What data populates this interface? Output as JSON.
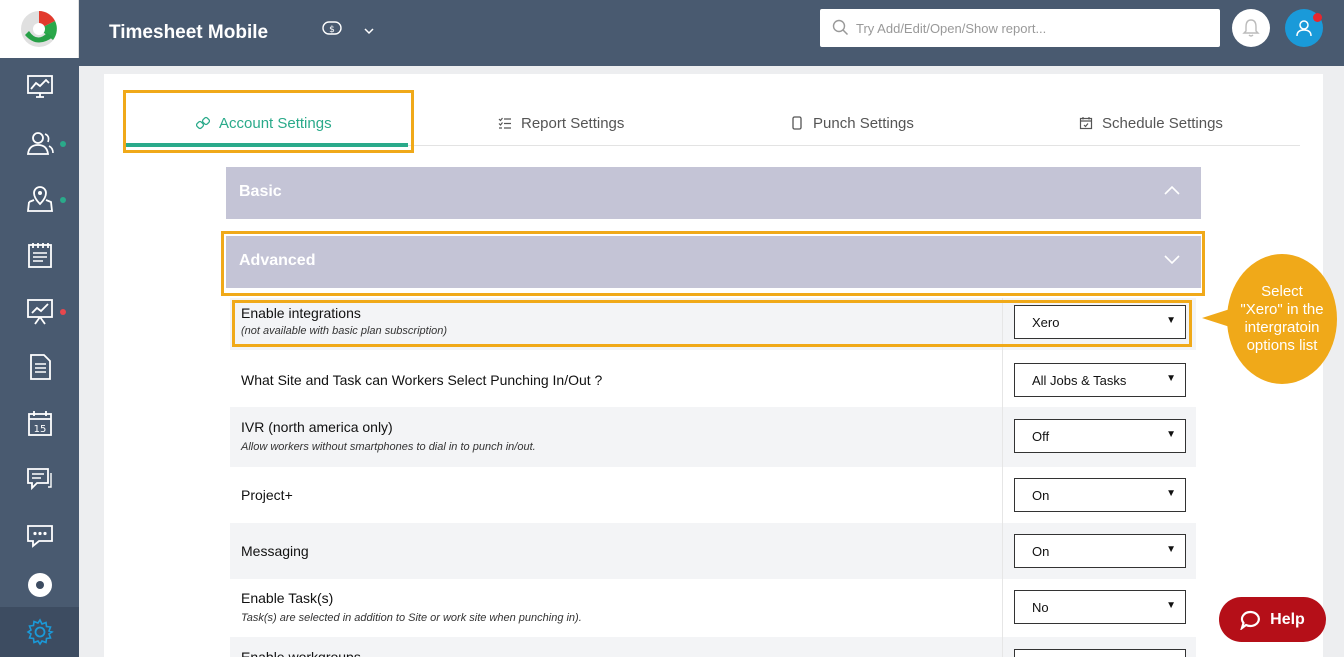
{
  "header": {
    "title": "Timesheet Mobile",
    "currency_icon": "currency-icon",
    "search_placeholder": "Try Add/Edit/Open/Show report..."
  },
  "sidebar": {
    "items": [
      {
        "name": "dashboard-icon"
      },
      {
        "name": "workers-icon",
        "dot": "#2aaa8a"
      },
      {
        "name": "sites-map-icon",
        "dot": "#2aaa8a"
      },
      {
        "name": "timesheet-icon"
      },
      {
        "name": "reports-icon",
        "dot": "#e8474d"
      },
      {
        "name": "document-icon"
      },
      {
        "name": "calendar-icon",
        "day": "15"
      },
      {
        "name": "messages-icon"
      },
      {
        "name": "chat-bubble-icon"
      },
      {
        "name": "record-icon"
      },
      {
        "name": "settings-gear-icon",
        "active": true
      }
    ]
  },
  "tabs": [
    {
      "label": "Account Settings",
      "active": true
    },
    {
      "label": "Report Settings"
    },
    {
      "label": "Punch Settings"
    },
    {
      "label": "Schedule Settings"
    }
  ],
  "sections": {
    "basic": "Basic",
    "advanced": "Advanced"
  },
  "settings": [
    {
      "label": "Enable integrations",
      "sub": "(not available with basic plan subscription)",
      "value": "Xero"
    },
    {
      "label": "What Site and Task can Workers Select Punching In/Out ?",
      "sub": "",
      "value": "All Jobs & Tasks"
    },
    {
      "label": "IVR (north america only)",
      "sub": "Allow workers without smartphones to dial in to punch in/out.",
      "value": "Off"
    },
    {
      "label": "Project+",
      "sub": "",
      "value": "On"
    },
    {
      "label": "Messaging",
      "sub": "",
      "value": "On"
    },
    {
      "label": "Enable Task(s)",
      "sub": "Task(s) are selected in addition to Site or work site when punching in).",
      "value": "No"
    },
    {
      "label": "Enable workgroups",
      "sub": "",
      "value": ""
    }
  ],
  "callout": {
    "text": "Select \"Xero\" in the intergratoin options list"
  },
  "help": {
    "label": "Help"
  },
  "colors": {
    "sidebar": "#495a70",
    "accent": "#2aaa8a",
    "highlight": "#f0a919",
    "help": "#b50f18"
  }
}
